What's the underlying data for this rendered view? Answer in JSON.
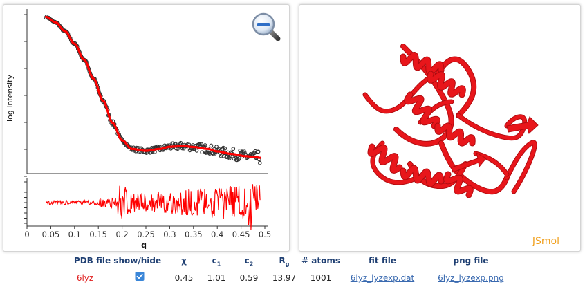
{
  "plot": {
    "ylabel": "log  intensity",
    "xlabel": "q",
    "x_ticks": [
      "0",
      "0.05",
      "0.1",
      "0.15",
      "0.2",
      "0.25",
      "0.3",
      "0.35",
      "0.4",
      "0.45",
      "0.5"
    ],
    "zoom_button": "zoom-out"
  },
  "chart_data": {
    "type": "scatter",
    "title": "",
    "xlabel": "q",
    "ylabel": "log  intensity",
    "xlim": [
      0,
      0.5
    ],
    "series": [
      {
        "kind": "experimental points",
        "points": [
          [
            0.04,
            4.95
          ],
          [
            0.06,
            4.78
          ],
          [
            0.08,
            4.5
          ],
          [
            0.1,
            4.1
          ],
          [
            0.12,
            3.6
          ],
          [
            0.14,
            3.0
          ],
          [
            0.16,
            2.3
          ],
          [
            0.18,
            1.6
          ],
          [
            0.2,
            1.05
          ],
          [
            0.22,
            0.78
          ],
          [
            0.25,
            0.72
          ],
          [
            0.28,
            0.78
          ],
          [
            0.3,
            0.85
          ],
          [
            0.33,
            0.87
          ],
          [
            0.35,
            0.84
          ],
          [
            0.38,
            0.78
          ],
          [
            0.4,
            0.7
          ],
          [
            0.43,
            0.62
          ],
          [
            0.46,
            0.55
          ],
          [
            0.48,
            0.52
          ],
          [
            0.49,
            0.5
          ]
        ]
      },
      {
        "kind": "fit curve",
        "points": [
          [
            0.04,
            4.95
          ],
          [
            0.06,
            4.78
          ],
          [
            0.08,
            4.5
          ],
          [
            0.1,
            4.1
          ],
          [
            0.12,
            3.6
          ],
          [
            0.14,
            3.0
          ],
          [
            0.16,
            2.3
          ],
          [
            0.18,
            1.6
          ],
          [
            0.2,
            1.05
          ],
          [
            0.22,
            0.78
          ],
          [
            0.25,
            0.72
          ],
          [
            0.28,
            0.78
          ],
          [
            0.3,
            0.85
          ],
          [
            0.33,
            0.87
          ],
          [
            0.35,
            0.84
          ],
          [
            0.38,
            0.78
          ],
          [
            0.4,
            0.7
          ],
          [
            0.43,
            0.62
          ],
          [
            0.46,
            0.55
          ],
          [
            0.48,
            0.52
          ],
          [
            0.49,
            0.5
          ]
        ]
      }
    ],
    "residuals_panel": "noise around zero, amplitude growing with q"
  },
  "jsmol": {
    "label": "JSmol",
    "structure_color": "#e8161b"
  },
  "results": {
    "headers": {
      "pdb": "PDB file show/hide",
      "chi": "χ",
      "c1": "c",
      "c1_sub": "1",
      "c2": "c",
      "c2_sub": "2",
      "rg": "R",
      "rg_sub": "g",
      "atoms": "# atoms",
      "fit": "fit file",
      "png": "png file"
    },
    "row": {
      "pdb_name": "6lyz",
      "show_checked": true,
      "chi": "0.45",
      "c1": "1.01",
      "c2": "0.59",
      "rg": "13.97",
      "atoms": "1001",
      "fit_file": "6lyz_lyzexp.dat",
      "png_file": "6lyz_lyzexp.png"
    }
  },
  "colors": {
    "accent": "#1f3f72",
    "fit": "#ff0000",
    "link": "#3a6ab0",
    "pdb_name": "#e02020",
    "jsmol_label": "#f0a01e"
  }
}
